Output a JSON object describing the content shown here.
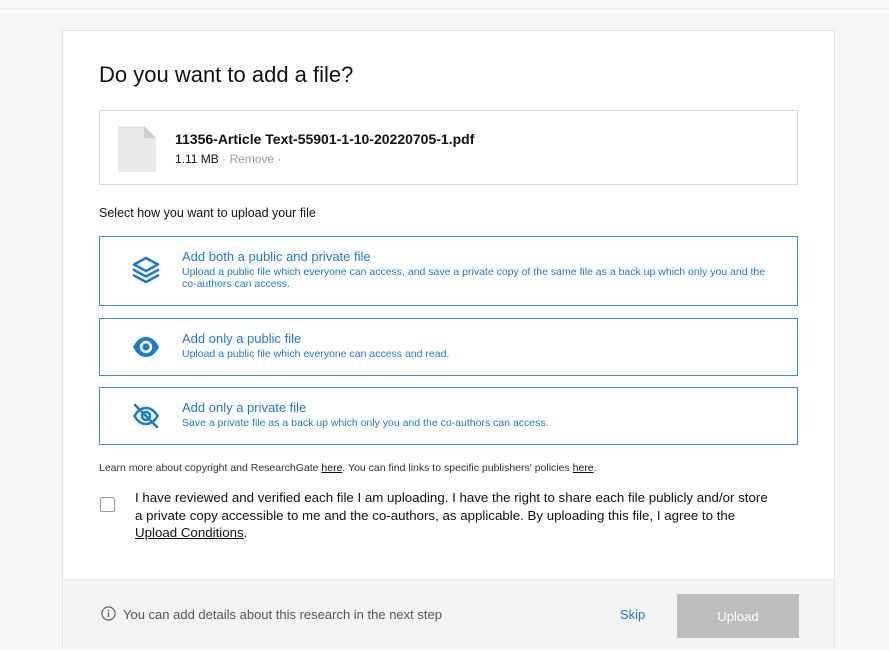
{
  "dialog": {
    "title": "Do you want to add a file?"
  },
  "file": {
    "name": "11356-Article Text-55901-1-10-20220705-1.pdf",
    "size": "1.11 MB",
    "separator1": " · ",
    "remove_label": "Remove",
    "separator2": " ·"
  },
  "upload_prompt": "Select how you want to upload your file",
  "options": [
    {
      "icon": "layers-icon",
      "title": "Add both a public and private file",
      "description": "Upload a public file which everyone can access, and save a private copy of the same file as a back up which only you and the co-authors can access."
    },
    {
      "icon": "eye-icon",
      "title": "Add only a public file",
      "description": "Upload a public file which everyone can access and read."
    },
    {
      "icon": "eye-slash-icon",
      "title": "Add only a private file",
      "description": "Save a private file as a back up which only you and the co-authors can access."
    }
  ],
  "legal": {
    "text1": "Learn more about copyright and ResearchGate ",
    "link1": "here",
    "text2": ". You can find links to specific publishers' policies ",
    "link2": "here",
    "text3": "."
  },
  "agreement": {
    "checked": false,
    "text": "I have reviewed and verified each file I am uploading. I have the right to share each file publicly and/or store a private copy accessible to me and the co-authors, as applicable. By uploading this file, I agree to the ",
    "link": "Upload Conditions",
    "end": "."
  },
  "footer": {
    "note": "You can add details about this research in the next step",
    "skip_label": "Skip",
    "upload_label": "Upload"
  },
  "colors": {
    "accent": "#1a7ad4",
    "option_border": "#2f8fd6",
    "disabled_button": "#bdbdbd"
  }
}
